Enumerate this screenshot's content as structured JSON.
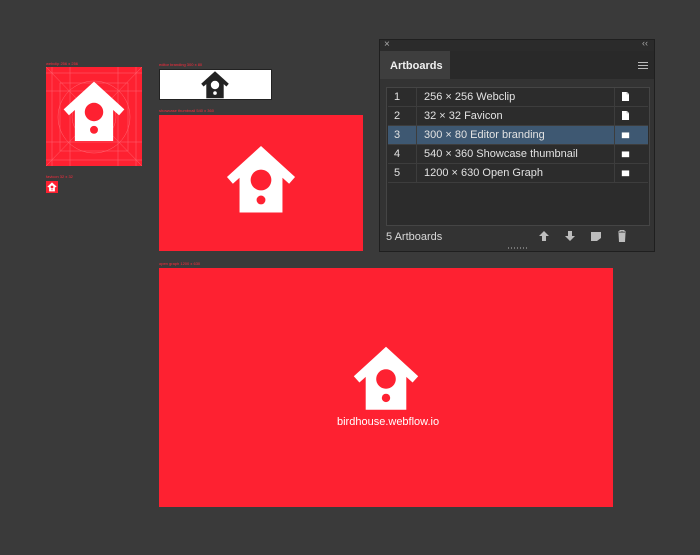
{
  "canvas": {
    "background": "#3a3a3a",
    "brand_red": "#fe2131",
    "artboards": [
      {
        "label": "webclip 256 x 256",
        "icon": "birdhouse-icon",
        "has_guides": true
      },
      {
        "label": "favicon 32 x 32",
        "icon": "birdhouse-icon"
      },
      {
        "label": "editor branding 300 x 80",
        "icon": "birdhouse-icon-dark"
      },
      {
        "label": "showcase thumbnail 540 x 360",
        "icon": "birdhouse-icon"
      },
      {
        "label": "open graph 1200 x 630",
        "icon": "birdhouse-icon",
        "caption": "birdhouse.webflow.io"
      }
    ]
  },
  "panel": {
    "close_icon": "×",
    "collapse_icon": "‹‹",
    "tab_label": "Artboards",
    "menu_icon": "hamburger-menu-icon",
    "rows": [
      {
        "num": "1",
        "name": "256 × 256 Webclip",
        "selected": false
      },
      {
        "num": "2",
        "name": "32 × 32 Favicon",
        "selected": false
      },
      {
        "num": "3",
        "name": "300 × 80 Editor branding",
        "selected": true
      },
      {
        "num": "4",
        "name": "540 × 360 Showcase thumbnail",
        "selected": false
      },
      {
        "num": "5",
        "name": "1200 × 630 Open Graph",
        "selected": false
      }
    ],
    "footer_label": "5 Artboards",
    "footer_buttons": [
      "move-up-arrow-icon",
      "move-down-arrow-icon",
      "new-artboard-icon",
      "trash-icon"
    ]
  }
}
